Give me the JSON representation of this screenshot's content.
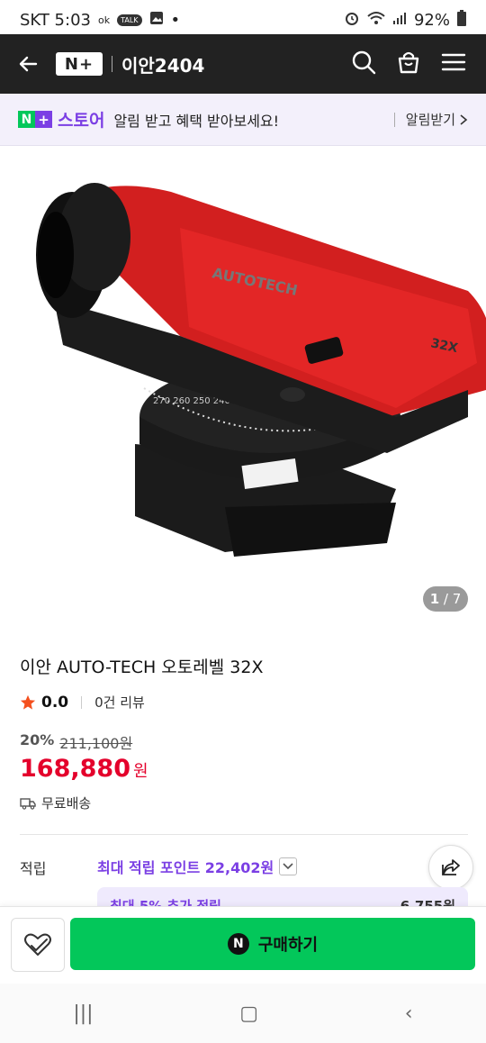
{
  "status_bar": {
    "carrier_time": "SKT 5:03",
    "ok_label": "ok",
    "talk_label": "TALK",
    "dot": "•",
    "battery": "92%"
  },
  "header": {
    "logo_text": "N+",
    "store_name": "이안2404"
  },
  "banner": {
    "store_label": "스토어",
    "message": "알림 받고 혜택 받아보세요!",
    "cta": "알림받기"
  },
  "product": {
    "image_pager_current": "1",
    "image_pager_total": "7",
    "image_brand_text": "AUTOTECH",
    "image_model_text": "32X",
    "title": "이안 AUTO-TECH 오토레벨 32X",
    "rating": "0.0",
    "reviews": "0건 리뷰",
    "discount_pct": "20%",
    "original_price": "211,100원",
    "price": "168,880",
    "price_unit": "원",
    "shipping": "무료배송"
  },
  "points": {
    "label": "적립",
    "value": "최대 적립 포인트 22,402원",
    "card_row_left": "최대 5% 추가 적립",
    "card_row_right": "6,755원"
  },
  "actions": {
    "buy_label": "구매하기",
    "buy_logo": "N"
  },
  "nav": {
    "recent": "|||",
    "home": "▢",
    "back": "‹"
  },
  "colors": {
    "accent_purple": "#7b3fe4",
    "naver_green": "#03c75a",
    "price_red": "#e4002b",
    "header_dark": "#222222"
  }
}
